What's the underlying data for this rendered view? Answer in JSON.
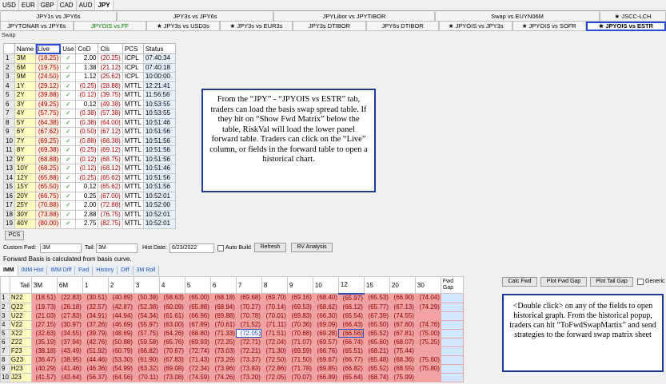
{
  "ccy_tabs": [
    "USD",
    "EUR",
    "GBP",
    "CAD",
    "AUD",
    "JPY"
  ],
  "active_ccy": "JPY",
  "pair_row1": [
    "JPY1s vs JPY6s",
    "JPY3s vs JPY6s",
    "JPYLibor vs JPYTIBOR",
    "Swap vs EUYN06M",
    "JSCC-LCH"
  ],
  "pair_row2": [
    "JPYTONAR vs JPY6s",
    "JPYOIS vs FF",
    "JPY3s vs USD3s",
    "JPY3s vs EUR3s",
    "JPY3s DTIBOR",
    "JPY6s DTIBOR",
    "JPYOIS vs JPY3s",
    "JPYOIS vs SOFR",
    "JPYOIS vs ESTR"
  ],
  "swap_caption": "Swap",
  "swap_headers": [
    "",
    "Name",
    "Live",
    "Use",
    "CoD",
    "Cls",
    "PCS",
    "Status"
  ],
  "swap_rows": [
    [
      "1",
      "3M",
      "(18.25)",
      "✓",
      "2.00",
      "(20.25)",
      "ICPL",
      "07:40:34"
    ],
    [
      "2",
      "6M",
      "(19.75)",
      "✓",
      "1.38",
      "(21.12)",
      "ICPL",
      "07:40:18"
    ],
    [
      "3",
      "9M",
      "(24.50)",
      "✓",
      "1.12",
      "(25.62)",
      "ICPL",
      "10:00:00"
    ],
    [
      "4",
      "1Y",
      "(29.12)",
      "✓",
      "(0.25)",
      "(28.88)",
      "MTTL",
      "12:21:41"
    ],
    [
      "5",
      "2Y",
      "(39.88)",
      "✓",
      "(0.12)",
      "(39.75)",
      "MTTL",
      "11:56:56"
    ],
    [
      "6",
      "3Y",
      "(49.25)",
      "✓",
      "0.12",
      "(49.38)",
      "MTTL",
      "10:53:55"
    ],
    [
      "7",
      "4Y",
      "(57.75)",
      "✓",
      "(0.38)",
      "(57.38)",
      "MTTL",
      "10:53:55"
    ],
    [
      "8",
      "5Y",
      "(64.38)",
      "✓",
      "(0.38)",
      "(64.00)",
      "MTTL",
      "10:51:46"
    ],
    [
      "9",
      "6Y",
      "(67.62)",
      "✓",
      "(0.50)",
      "(67.12)",
      "MTTL",
      "10:51:56"
    ],
    [
      "10",
      "7Y",
      "(69.25)",
      "✓",
      "(0.88)",
      "(68.38)",
      "MTTL",
      "10:51:56"
    ],
    [
      "11",
      "8Y",
      "(69.38)",
      "✓",
      "(0.25)",
      "(69.12)",
      "MTTL",
      "10:51:56"
    ],
    [
      "12",
      "9Y",
      "(68.88)",
      "✓",
      "(0.12)",
      "(68.75)",
      "MTTL",
      "10:51:56"
    ],
    [
      "13",
      "10Y",
      "(68.25)",
      "✓",
      "(0.12)",
      "(68.12)",
      "MTTL",
      "10:51:46"
    ],
    [
      "14",
      "12Y",
      "(65.88)",
      "✓",
      "(0.25)",
      "(65.62)",
      "MTTL",
      "10:51:56"
    ],
    [
      "15",
      "15Y",
      "(65.50)",
      "✓",
      "0.12",
      "(65.62)",
      "MTTL",
      "10:51:56"
    ],
    [
      "16",
      "20Y",
      "(66.75)",
      "✓",
      "0.25",
      "(67.00)",
      "MTTL",
      "10:52:01"
    ],
    [
      "17",
      "25Y",
      "(70.88)",
      "✓",
      "2.00",
      "(72.88)",
      "MTTL",
      "10:52:00"
    ],
    [
      "18",
      "30Y",
      "(73.88)",
      "✓",
      "2.88",
      "(76.75)",
      "MTTL",
      "10:52:01"
    ],
    [
      "19",
      "40Y",
      "(80.00)",
      "✓",
      "2.75",
      "(82.75)",
      "MTTL",
      "10:52:01"
    ]
  ],
  "note1": "From the “JPY” - “JPYOIS vs ESTR” tab, traders can load the basis swap spread table. If they hit on “Show Fwd Matrix” below the table, RiskVal will load the lower panel forward table. Traders can click on the “Live” column, or fields in the forward table to open a historical chart.",
  "pcs_button": "PCS",
  "controls": {
    "custom_fwd_label": "Custom Fwd:",
    "custom_fwd_value": "3M",
    "tail_label": "Tail:",
    "tail_value": "3M",
    "hist_date_label": "Hist Date:",
    "hist_date_value": "6/23/2022",
    "auto_build_label": "Auto Build",
    "refresh_button": "Refresh",
    "rv_button": "RV Analysis"
  },
  "fwd_basis_text": "Forward Basis is calculated from basis curve.",
  "bottom_tabs": [
    "IMM",
    "IMM Hist",
    "IMM Diff",
    "Fwd",
    "History",
    "Diff",
    "3M Roll"
  ],
  "right_buttons": [
    "Calc Fwd",
    "Plot Fwd Gap",
    "Plot Tail Gap",
    "Generic"
  ],
  "fwd_tail_label": "Tail",
  "fwd_headers": [
    "3M",
    "6M",
    "1",
    "2",
    "3",
    "4",
    "5",
    "6",
    "7",
    "8",
    "9",
    "10",
    "12",
    "15",
    "20",
    "30"
  ],
  "fwd_gap_label": "Fwd Gap",
  "fwd_rows": [
    {
      "n": "1",
      "t": "N22",
      "v": [
        "(18.51)",
        "(22.83)",
        "(30.51)",
        "(40.89)",
        "(50.38)",
        "(58.63)",
        "(65.00)",
        "(68.18)",
        "(69.68)",
        "(69.70)",
        "(69.16)",
        "(68.40)",
        "(65.97)",
        "(65.53)",
        "(66.90)",
        "(74.04)"
      ]
    },
    {
      "n": "2",
      "t": "Q22",
      "v": [
        "(19.73)",
        "(26.18)",
        "(32.57)",
        "(42.87)",
        "(52.38)",
        "(60.09)",
        "(65.88)",
        "(68.94)",
        "(70.27)",
        "(70.14)",
        "(69.53)",
        "(68.62)",
        "(66.12)",
        "(65.77)",
        "(67.13)",
        "(74.29)"
      ]
    },
    {
      "n": "3",
      "t": "U22",
      "v": [
        "(21.03)",
        "(27.83)",
        "(34.91)",
        "(44.94)",
        "(54.34)",
        "(61.61)",
        "(66.96)",
        "(69.88)",
        "(70.78)",
        "(70.01)",
        "(69.83)",
        "(66.30)",
        "(65.54)",
        "(67.39)",
        "(74.55)",
        ""
      ]
    },
    {
      "n": "4",
      "t": "V22",
      "v": [
        "(27.15)",
        "(30.97)",
        "(37.26)",
        "(46.69)",
        "(55.97)",
        "(63.00)",
        "(67.89)",
        "(70.61)",
        "(71.52)",
        "(71.11)",
        "(70.36)",
        "(69.09)",
        "(66.43)",
        "(65.50)",
        "(67.60)",
        "(74.76)"
      ]
    },
    {
      "n": "5",
      "t": "X22",
      "v": [
        "(32.63)",
        "(34.55)",
        "(39.79)",
        "(48.69)",
        "(57.75)",
        "(64.26)",
        "(68.80)",
        "(71.33)",
        "(72.05)",
        "(71.51)",
        "(70.68)",
        "(69.28)",
        "(66.56)",
        "(65.52)",
        "(67.81)",
        "(75.00)"
      ]
    },
    {
      "n": "6",
      "t": "Z22",
      "v": [
        "(35.19)",
        "(37.94)",
        "(42.76)",
        "(50.88)",
        "(59.58)",
        "(65.76)",
        "(69.93)",
        "(72.25)",
        "(72.71)",
        "(72.04)",
        "(71.07)",
        "(69.57)",
        "(66.74)",
        "(65.60)",
        "(68.07)",
        "(75.25)"
      ]
    },
    {
      "n": "7",
      "t": "F23",
      "v": [
        "(38.18)",
        "(43.49)",
        "(51.92)",
        "(60.79)",
        "(66.82)",
        "(70.67)",
        "(72.74)",
        "(73.03)",
        "(72.21)",
        "(71.30)",
        "(69.59)",
        "(66.76)",
        "(65.51)",
        "(68.21)",
        "(75.44)",
        ""
      ]
    },
    {
      "n": "8",
      "t": "G23",
      "v": [
        "(36.47)",
        "(38.95)",
        "(44.46)",
        "(53.30)",
        "(61.90)",
        "(67.83)",
        "(71.43)",
        "(73.29)",
        "(73.37)",
        "(72.50)",
        "(71.50)",
        "(69.67)",
        "(66.77)",
        "(65.48)",
        "(68.36)",
        "(75.60)"
      ]
    },
    {
      "n": "9",
      "t": "H23",
      "v": [
        "(40.29)",
        "(41.46)",
        "(46.36)",
        "(54.99)",
        "(63.32)",
        "(69.08)",
        "(72.34)",
        "(73.96)",
        "(73.83)",
        "(72.86)",
        "(71.78)",
        "(69.85)",
        "(66.82)",
        "(65.52)",
        "(68.55)",
        "(75.80)"
      ]
    },
    {
      "n": "10",
      "t": "J23",
      "v": [
        "(41.57)",
        "(43.64)",
        "(56.37)",
        "(64.56)",
        "(70.11)",
        "(73.08)",
        "(74.59)",
        "(74.26)",
        "(73.20)",
        "(72.05)",
        "(70.07)",
        "(66.89)",
        "(65.64)",
        "(68.74)",
        "(75.99)",
        ""
      ]
    }
  ],
  "note2": "<Double click> on any of the fields to open historical graph. From the historical popup, traders can hit “ToFwdSwapMartix” and send strategies to the forward swap matrix sheet"
}
